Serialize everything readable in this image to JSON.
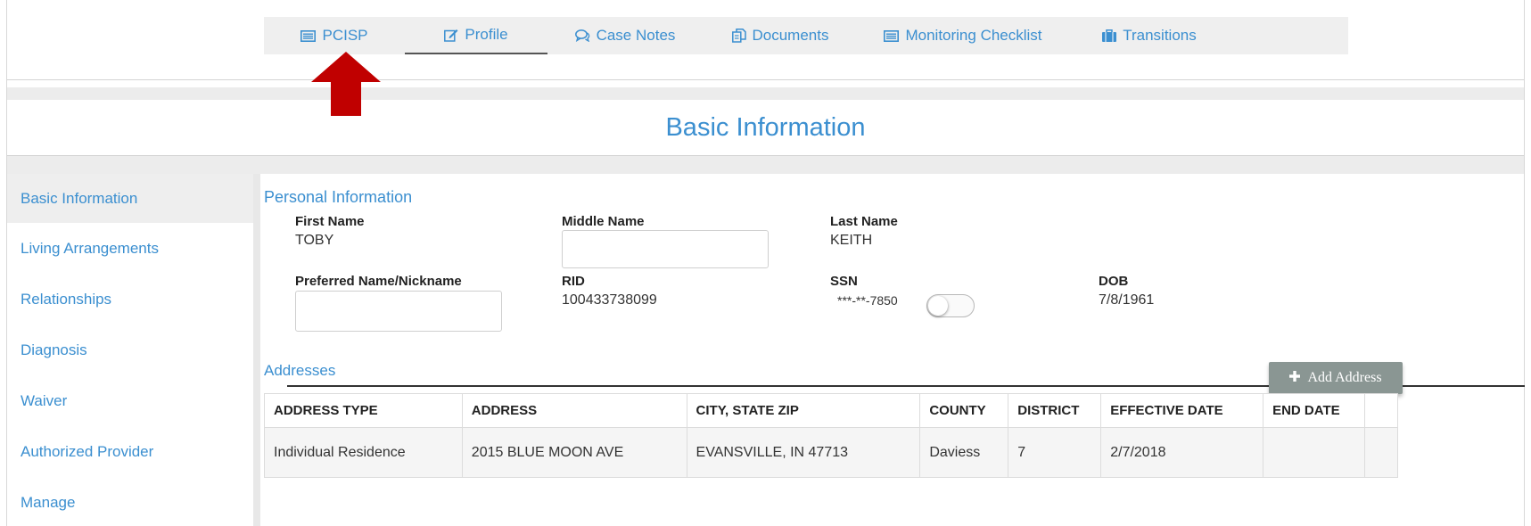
{
  "tabs": [
    {
      "label": "PCISP",
      "icon": "list-icon"
    },
    {
      "label": "Profile",
      "icon": "edit-icon"
    },
    {
      "label": "Case Notes",
      "icon": "comments-icon"
    },
    {
      "label": "Documents",
      "icon": "copy-icon"
    },
    {
      "label": "Monitoring Checklist",
      "icon": "list-icon"
    },
    {
      "label": "Transitions",
      "icon": "briefcase-icon"
    }
  ],
  "page_title": "Basic Information",
  "sidebar": {
    "items": [
      {
        "label": "Basic Information"
      },
      {
        "label": "Living Arrangements"
      },
      {
        "label": "Relationships"
      },
      {
        "label": "Diagnosis"
      },
      {
        "label": "Waiver"
      },
      {
        "label": "Authorized Provider"
      },
      {
        "label": "Manage"
      }
    ]
  },
  "personal": {
    "section_title": "Personal Information",
    "first_name_label": "First Name",
    "first_name": "TOBY",
    "middle_name_label": "Middle Name",
    "middle_name": "",
    "last_name_label": "Last Name",
    "last_name": "KEITH",
    "preferred_label": "Preferred Name/Nickname",
    "preferred": "",
    "rid_label": "RID",
    "rid": "100433738099",
    "ssn_label": "SSN",
    "ssn": "***-**-7850",
    "dob_label": "DOB",
    "dob": "7/8/1961"
  },
  "addresses": {
    "section_title": "Addresses",
    "add_button": "Add Address",
    "columns": [
      "ADDRESS TYPE",
      "ADDRESS",
      "CITY, STATE ZIP",
      "COUNTY",
      "DISTRICT",
      "EFFECTIVE DATE",
      "END DATE"
    ],
    "rows": [
      [
        "Individual Residence",
        "2015 BLUE MOON AVE",
        "EVANSVILLE, IN 47713",
        "Daviess",
        "7",
        "2/7/2018",
        ""
      ]
    ]
  },
  "colors": {
    "link": "#3b8fd0",
    "arrow": "#c00000",
    "button": "#8a9693"
  }
}
